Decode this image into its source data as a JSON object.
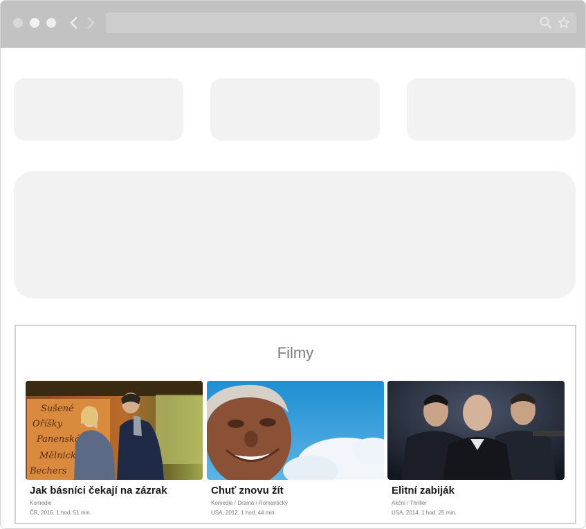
{
  "browser": {
    "back_icon": "chevron-left-icon",
    "forward_icon": "chevron-right-icon",
    "search_icon": "search-icon",
    "star_icon": "star-icon"
  },
  "films": {
    "heading": "Filmy",
    "items": [
      {
        "title": "Jak básníci čekají na zázrak",
        "genre": "Komedie",
        "meta": "ČR, 2016, 1 hod. 51 min."
      },
      {
        "title": "Chuť znovu žít",
        "genre": "Komedie / Drama / Romantický",
        "meta": "USA, 2012, 1 hod. 44 min."
      },
      {
        "title": "Elitní zabiják",
        "genre": "Akční / Thriller",
        "meta": "USA, 2014, 1 hod. 25 min."
      }
    ]
  },
  "colors": {
    "titlebar": "#c2c2c2",
    "placeholder": "#f2f2f2",
    "border": "#d0d0d0"
  }
}
